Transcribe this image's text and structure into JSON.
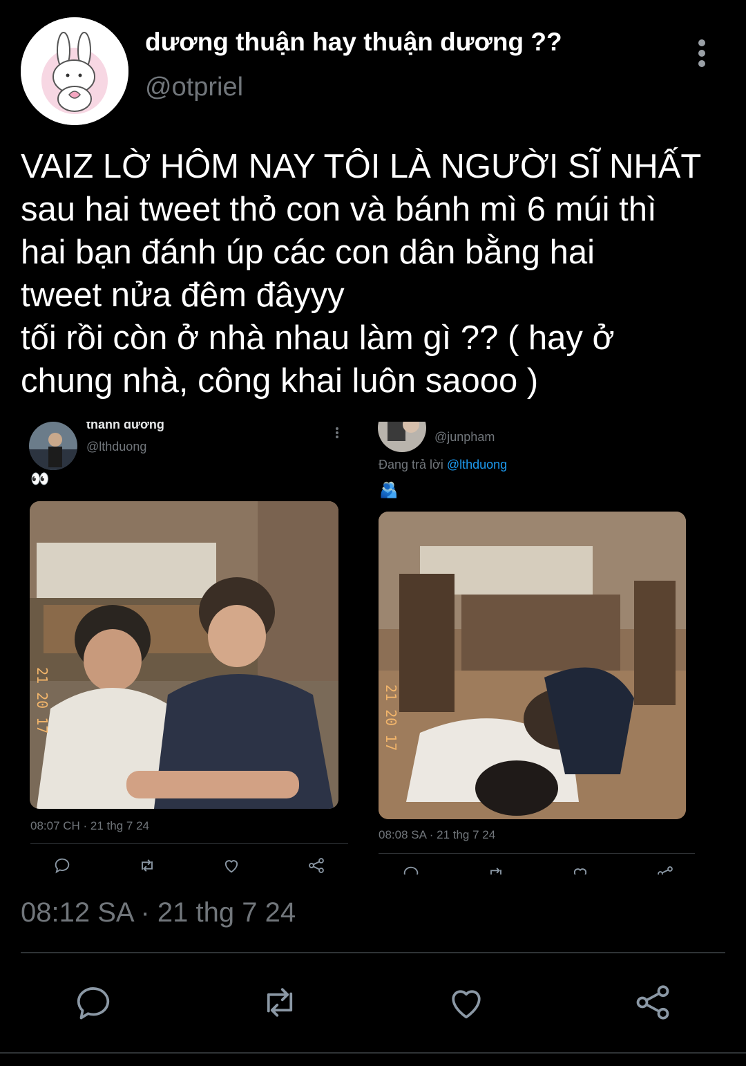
{
  "tweet": {
    "display_name": "dương thuận hay thuận dương ??",
    "handle": "@otpriel",
    "text": "VAIZ LỜ HÔM NAY TÔI LÀ NGƯỜI SĨ NHẤT\nsau hai tweet thỏ con và bánh mì 6 múi thì\nhai bạn đánh úp các con dân bằng hai\ntweet nửa đêm đâyyy\ntối rồi còn ở nhà nhau làm gì ?? ( hay ở\nchung nhà, công khai luôn saooo )",
    "timestamp": "08:12 SA · 21 thg 7 24"
  },
  "embeds": [
    {
      "display_name": "thanh dương",
      "handle": "@lthduong",
      "text": "👀",
      "photo_stamp": "21 20 17",
      "time": "08:07 CH · 21 thg 7 24"
    },
    {
      "handle": "@junpham",
      "reply_prefix": "Đang trả lời",
      "reply_to": "@lthduong",
      "text": "🫂",
      "photo_stamp": "21 20 17",
      "time": "08:08 SA · 21 thg 7 24"
    }
  ],
  "icons": {
    "more": "more-vertical-icon",
    "reply": "reply-icon",
    "retweet": "retweet-icon",
    "like": "like-icon",
    "share": "share-icon"
  },
  "colors": {
    "background": "#000000",
    "text": "#e7e9ea",
    "muted": "#71767b",
    "link": "#1d9bf0",
    "divider": "#2f3336"
  }
}
